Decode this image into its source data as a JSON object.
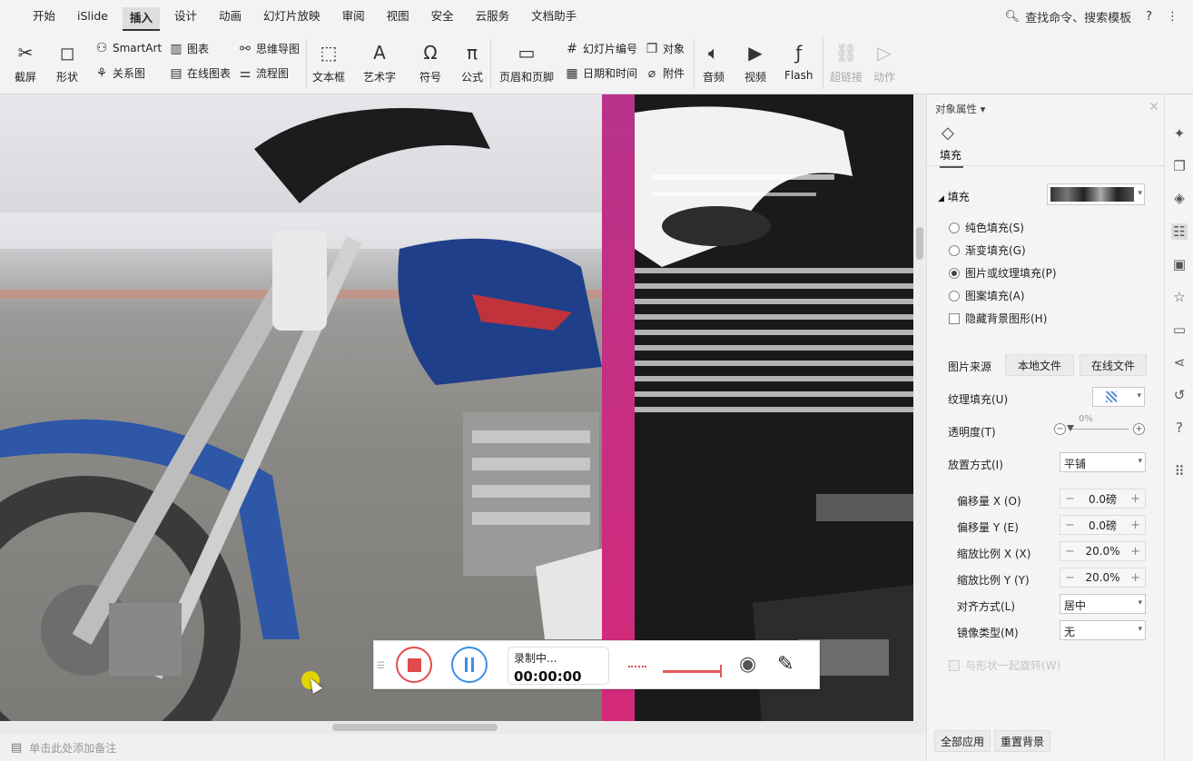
{
  "menu": {
    "items": [
      "开始",
      "iSlide",
      "插入",
      "设计",
      "动画",
      "幻灯片放映",
      "审阅",
      "视图",
      "安全",
      "云服务",
      "文档助手"
    ],
    "active_index": 2,
    "search_label": "查找命令、搜索模板",
    "help_icon": "?",
    "more_icon": "⋮"
  },
  "ribbon": {
    "screenshot": "截屏",
    "shapes": "形状",
    "smartart": "SmartArt",
    "chart": "图表",
    "mindmap": "思维导图",
    "relation": "关系图",
    "online_chart": "在线图表",
    "flowchart": "流程图",
    "textbox": "文本框",
    "wordart": "艺术字",
    "symbol": "符号",
    "formula": "公式",
    "header_footer": "页眉和页脚",
    "slide_number": "幻灯片编号",
    "datetime": "日期和时间",
    "object": "对象",
    "attachment": "附件",
    "audio": "音频",
    "video": "视频",
    "flash": "Flash",
    "hyperlink": "超链接",
    "action": "动作"
  },
  "recorder": {
    "status": "录制中...",
    "time": "00:00:00"
  },
  "notes": {
    "placeholder": "单击此处添加备注"
  },
  "panel": {
    "title": "对象属性",
    "tab": "填充",
    "section_fill": "填充",
    "fill_options": [
      {
        "label": "纯色填充(S)",
        "selected": false
      },
      {
        "label": "渐变填充(G)",
        "selected": false
      },
      {
        "label": "图片或纹理填充(P)",
        "selected": true
      },
      {
        "label": "图案填充(A)",
        "selected": false
      }
    ],
    "hide_bg": "隐藏背景图形(H)",
    "pic_source": "图片来源",
    "local_file": "本地文件",
    "online_file": "在线文件",
    "texture_fill": "纹理填充(U)",
    "transparency": "透明度(T)",
    "transparency_value": "0%",
    "transparency_fraction": 0,
    "placement": "放置方式(I)",
    "placement_value": "平铺",
    "offset_x": "偏移量 X (O)",
    "offset_x_value": "0.0磅",
    "offset_y": "偏移量 Y (E)",
    "offset_y_value": "0.0磅",
    "scale_x": "缩放比例 X (X)",
    "scale_x_value": "20.0%",
    "scale_y": "缩放比例 Y (Y)",
    "scale_y_value": "20.0%",
    "align": "对齐方式(L)",
    "align_value": "居中",
    "mirror": "镜像类型(M)",
    "mirror_value": "无",
    "rotate_with": "与形状一起旋转(W)",
    "apply_all": "全部应用",
    "reset_bg": "重置背景"
  },
  "colors": {
    "accent_pink": "#d52a7a",
    "record_red": "#e24b4b",
    "pause_blue": "#3a8ee6"
  }
}
